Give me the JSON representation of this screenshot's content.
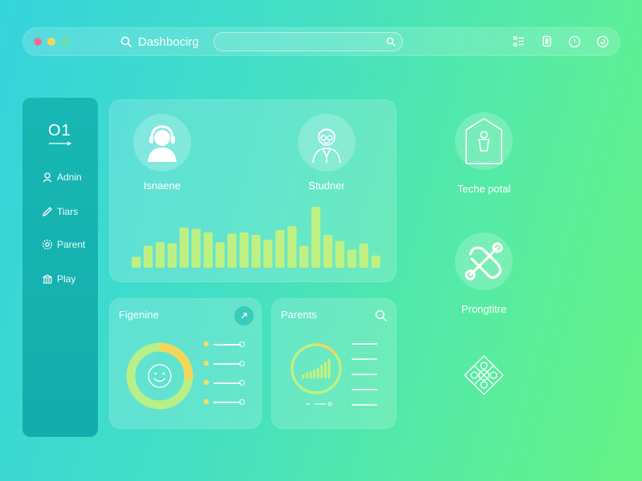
{
  "window": {
    "title": "Dashbocirg"
  },
  "search": {
    "placeholder": ""
  },
  "toolbar": {
    "icons": [
      "list-icon",
      "clipboard-icon",
      "timer-icon",
      "refresh-icon"
    ]
  },
  "sidebar": {
    "logo": "O1",
    "items": [
      {
        "label": "Adnin",
        "icon": "user-icon"
      },
      {
        "label": "Tiars",
        "icon": "pencil-icon"
      },
      {
        "label": "Parent",
        "icon": "gear-icon"
      },
      {
        "label": "Play",
        "icon": "building-icon"
      }
    ]
  },
  "main": {
    "profiles": [
      {
        "label": "Isnaene",
        "icon": "headset-user-icon"
      },
      {
        "label": "Studner",
        "icon": "student-avatar-icon"
      }
    ],
    "activity_bars": [
      0.18,
      0.36,
      0.42,
      0.4,
      0.66,
      0.64,
      0.58,
      0.42,
      0.56,
      0.58,
      0.54,
      0.46,
      0.62,
      0.68,
      0.36,
      1.0,
      0.54,
      0.44,
      0.3,
      0.4,
      0.2
    ],
    "accent": "#c8f27a"
  },
  "progress_card": {
    "title": "Figenine",
    "progress": 0.27,
    "rows": 4,
    "colors": {
      "ring": "#c8f27a",
      "highlight": "#f2d65a"
    }
  },
  "parents_card": {
    "title": "Parents",
    "mini_bars": [
      0.2,
      0.3,
      0.35,
      0.45,
      0.55,
      0.7,
      0.85,
      1.0
    ],
    "lines": 5
  },
  "right_panel": [
    {
      "label": "Teche potal",
      "icon": "shield-person-icon"
    },
    {
      "label": "Prongtitre",
      "icon": "tools-icon"
    },
    {
      "label": "",
      "icon": "network-diamond-icon"
    }
  ]
}
